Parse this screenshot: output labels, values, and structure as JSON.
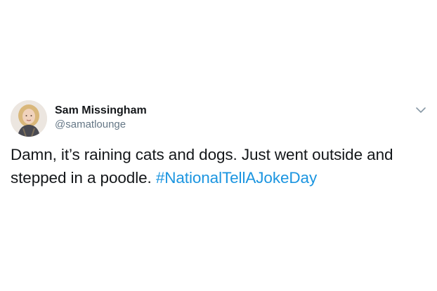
{
  "tweet": {
    "author": {
      "display_name": "Sam Missingham",
      "handle": "@samatlounge",
      "avatar_icon": "user-avatar-photo"
    },
    "text": "Damn, it’s raining cats and dogs. Just went outside and stepped in a poodle.",
    "hashtag": "#NationalTellAJokeDay",
    "menu_icon": "chevron-down-icon"
  },
  "colors": {
    "text": "#14171a",
    "secondary": "#657786",
    "link": "#1b95e0",
    "background": "#ffffff"
  }
}
